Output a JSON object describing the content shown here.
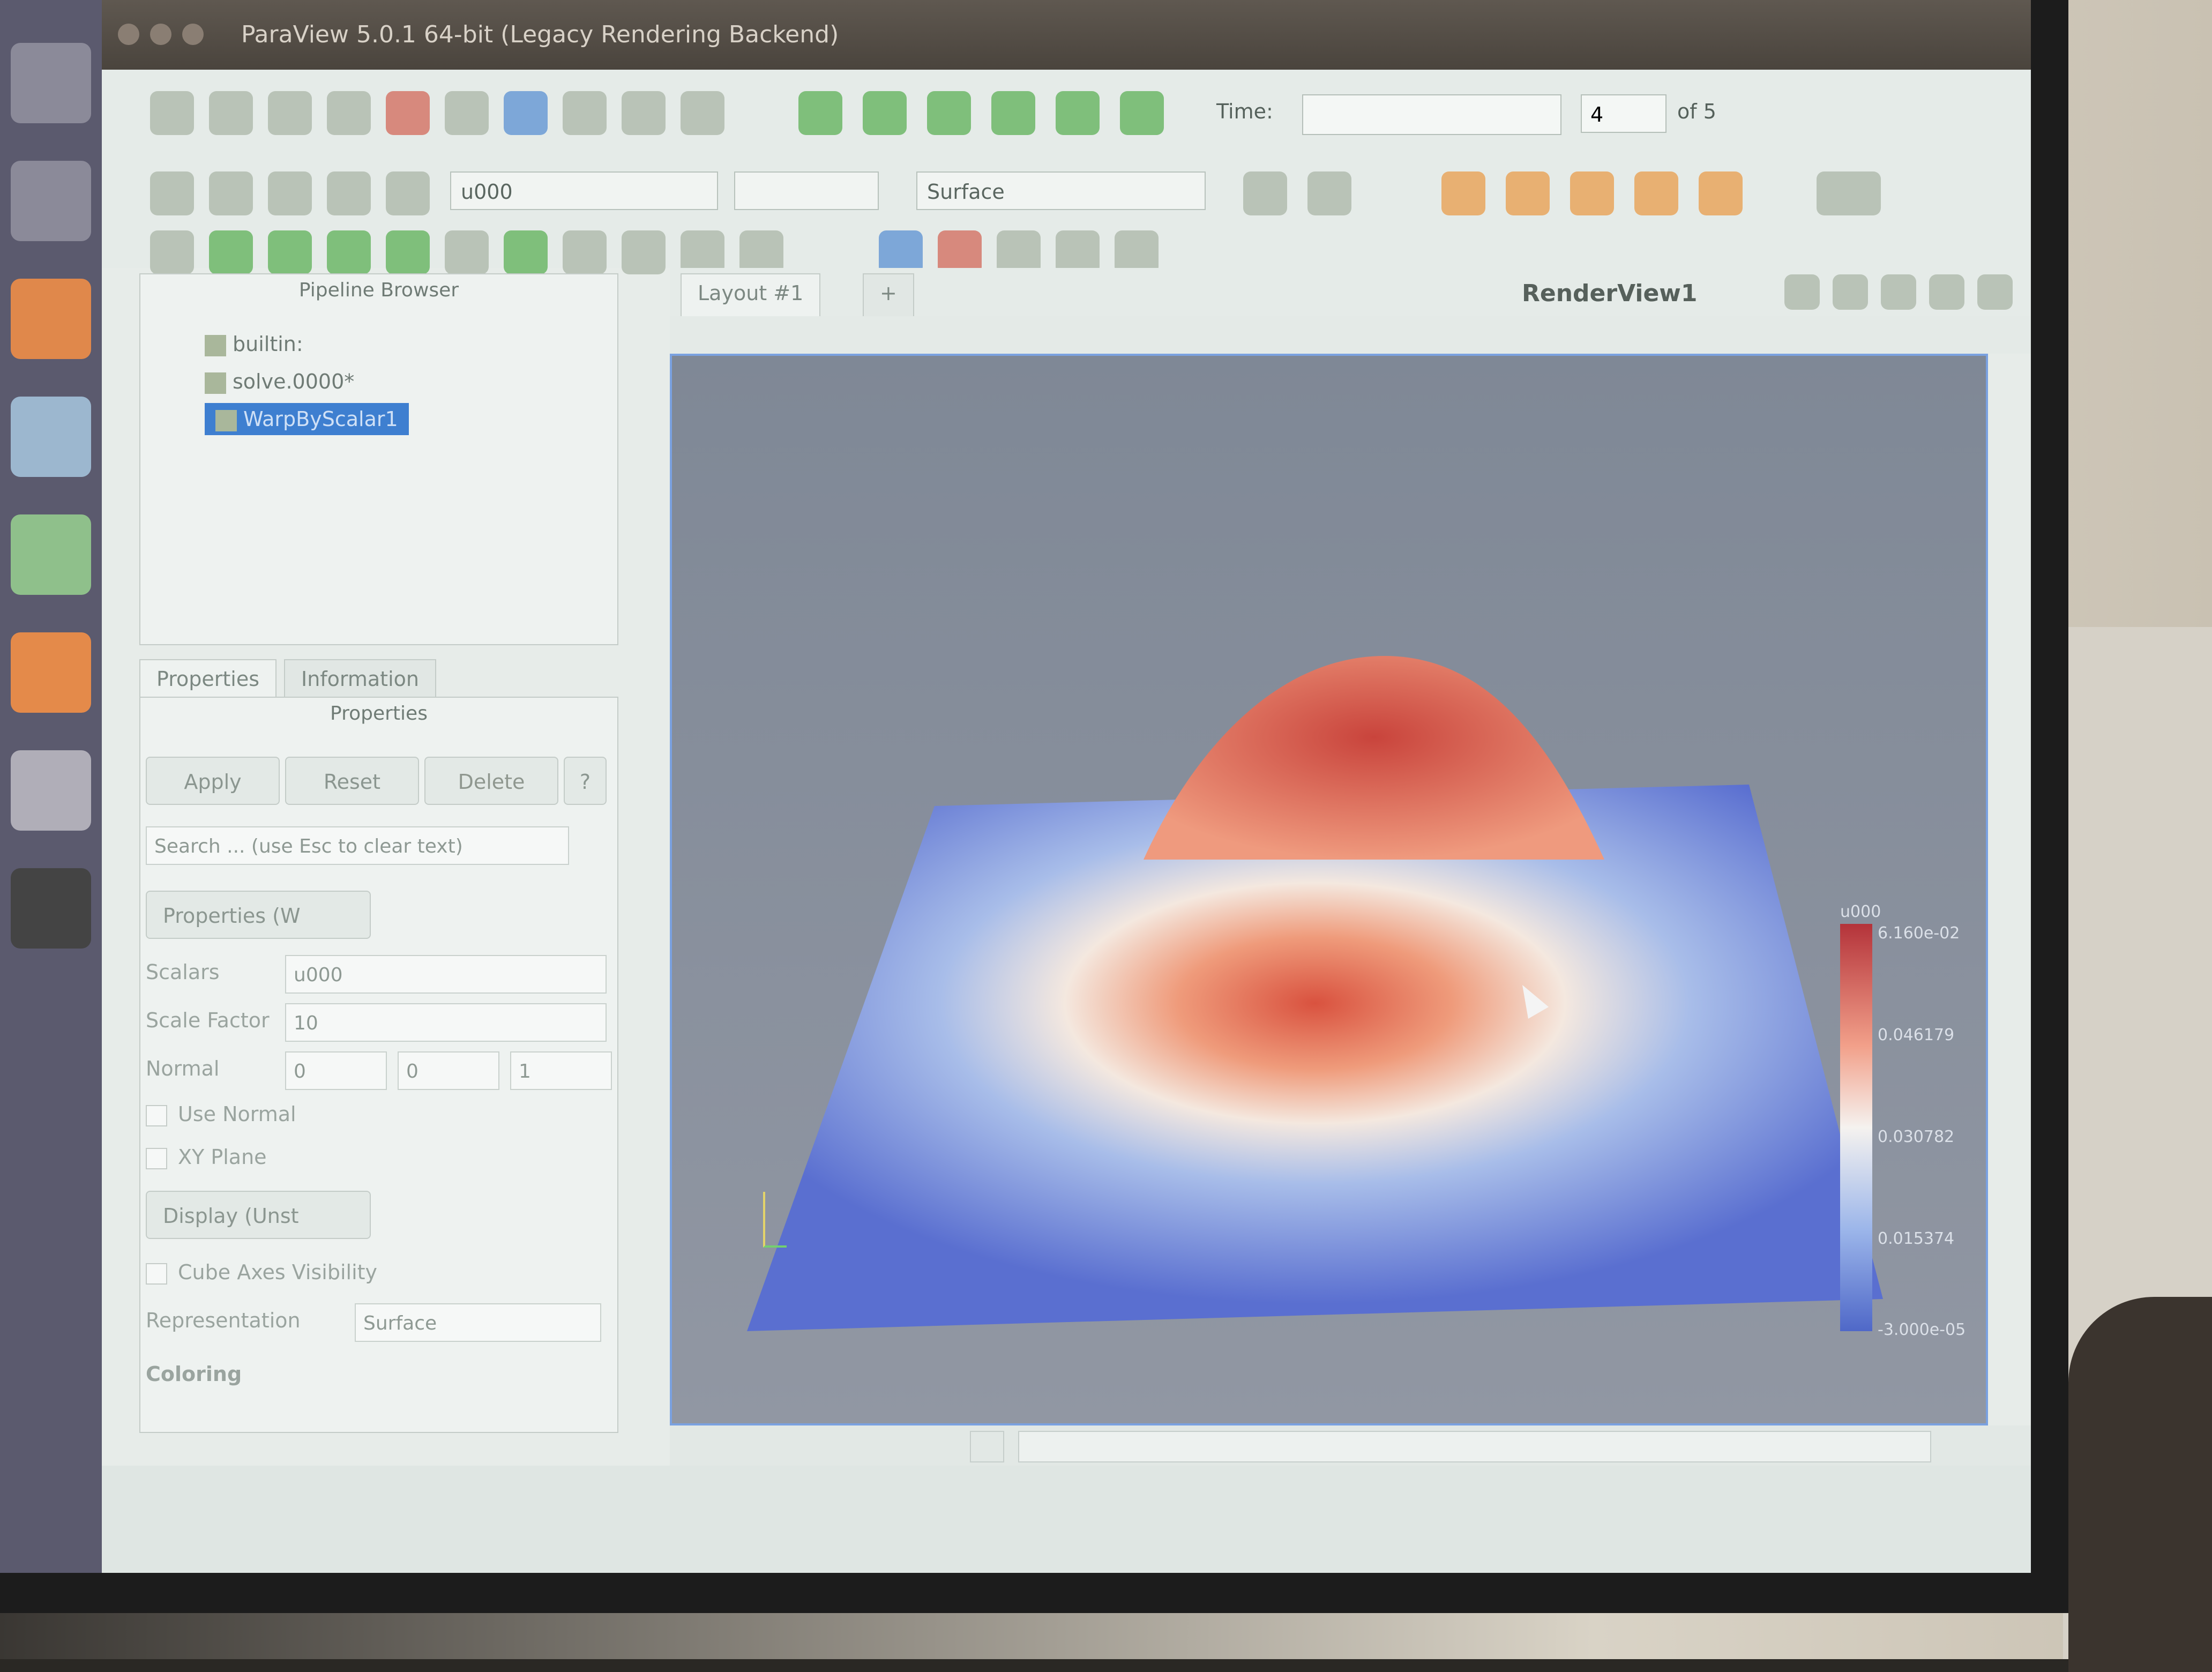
{
  "window": {
    "title": "ParaView 5.0.1 64-bit (Legacy Rendering Backend)"
  },
  "time_controls": {
    "label": "Time:",
    "value": "",
    "index": "4",
    "of": "of 5"
  },
  "toolbars": {
    "active_variable": "u000",
    "representation": "Surface"
  },
  "pipeline_browser": {
    "title": "Pipeline Browser",
    "items": [
      {
        "label": "builtin:"
      },
      {
        "label": "solve.0000*"
      },
      {
        "label": "WarpByScalar1"
      }
    ]
  },
  "properties_panel": {
    "tabs": [
      "Properties",
      "Information"
    ],
    "subtitle": "Properties",
    "buttons": {
      "apply": "Apply",
      "reset": "Reset",
      "delete": "Delete",
      "help": "?"
    },
    "search_placeholder": "Search ... (use Esc to clear text)",
    "section_properties": "Properties (W",
    "scalars_label": "Scalars",
    "scalars_value": "u000",
    "scale_factor_label": "Scale Factor",
    "scale_factor_value": "10",
    "normal_label": "Normal",
    "normal_values": [
      "0",
      "0",
      "1"
    ],
    "use_normal": "Use Normal",
    "xy_plane": "XY Plane",
    "section_display": "Display (Unst",
    "cube_axes": "Cube Axes Visibility",
    "representation_label": "Representation",
    "representation_value": "Surface",
    "coloring": "Coloring"
  },
  "render_view": {
    "layout_tab": "Layout #1",
    "add_tab": "+",
    "view_name": "RenderView1",
    "colorbar_title": "u000",
    "colorbar_ticks": [
      "6.160e-02",
      "0.046179",
      "0.030782",
      "0.015374",
      "-3.000e-05"
    ]
  }
}
